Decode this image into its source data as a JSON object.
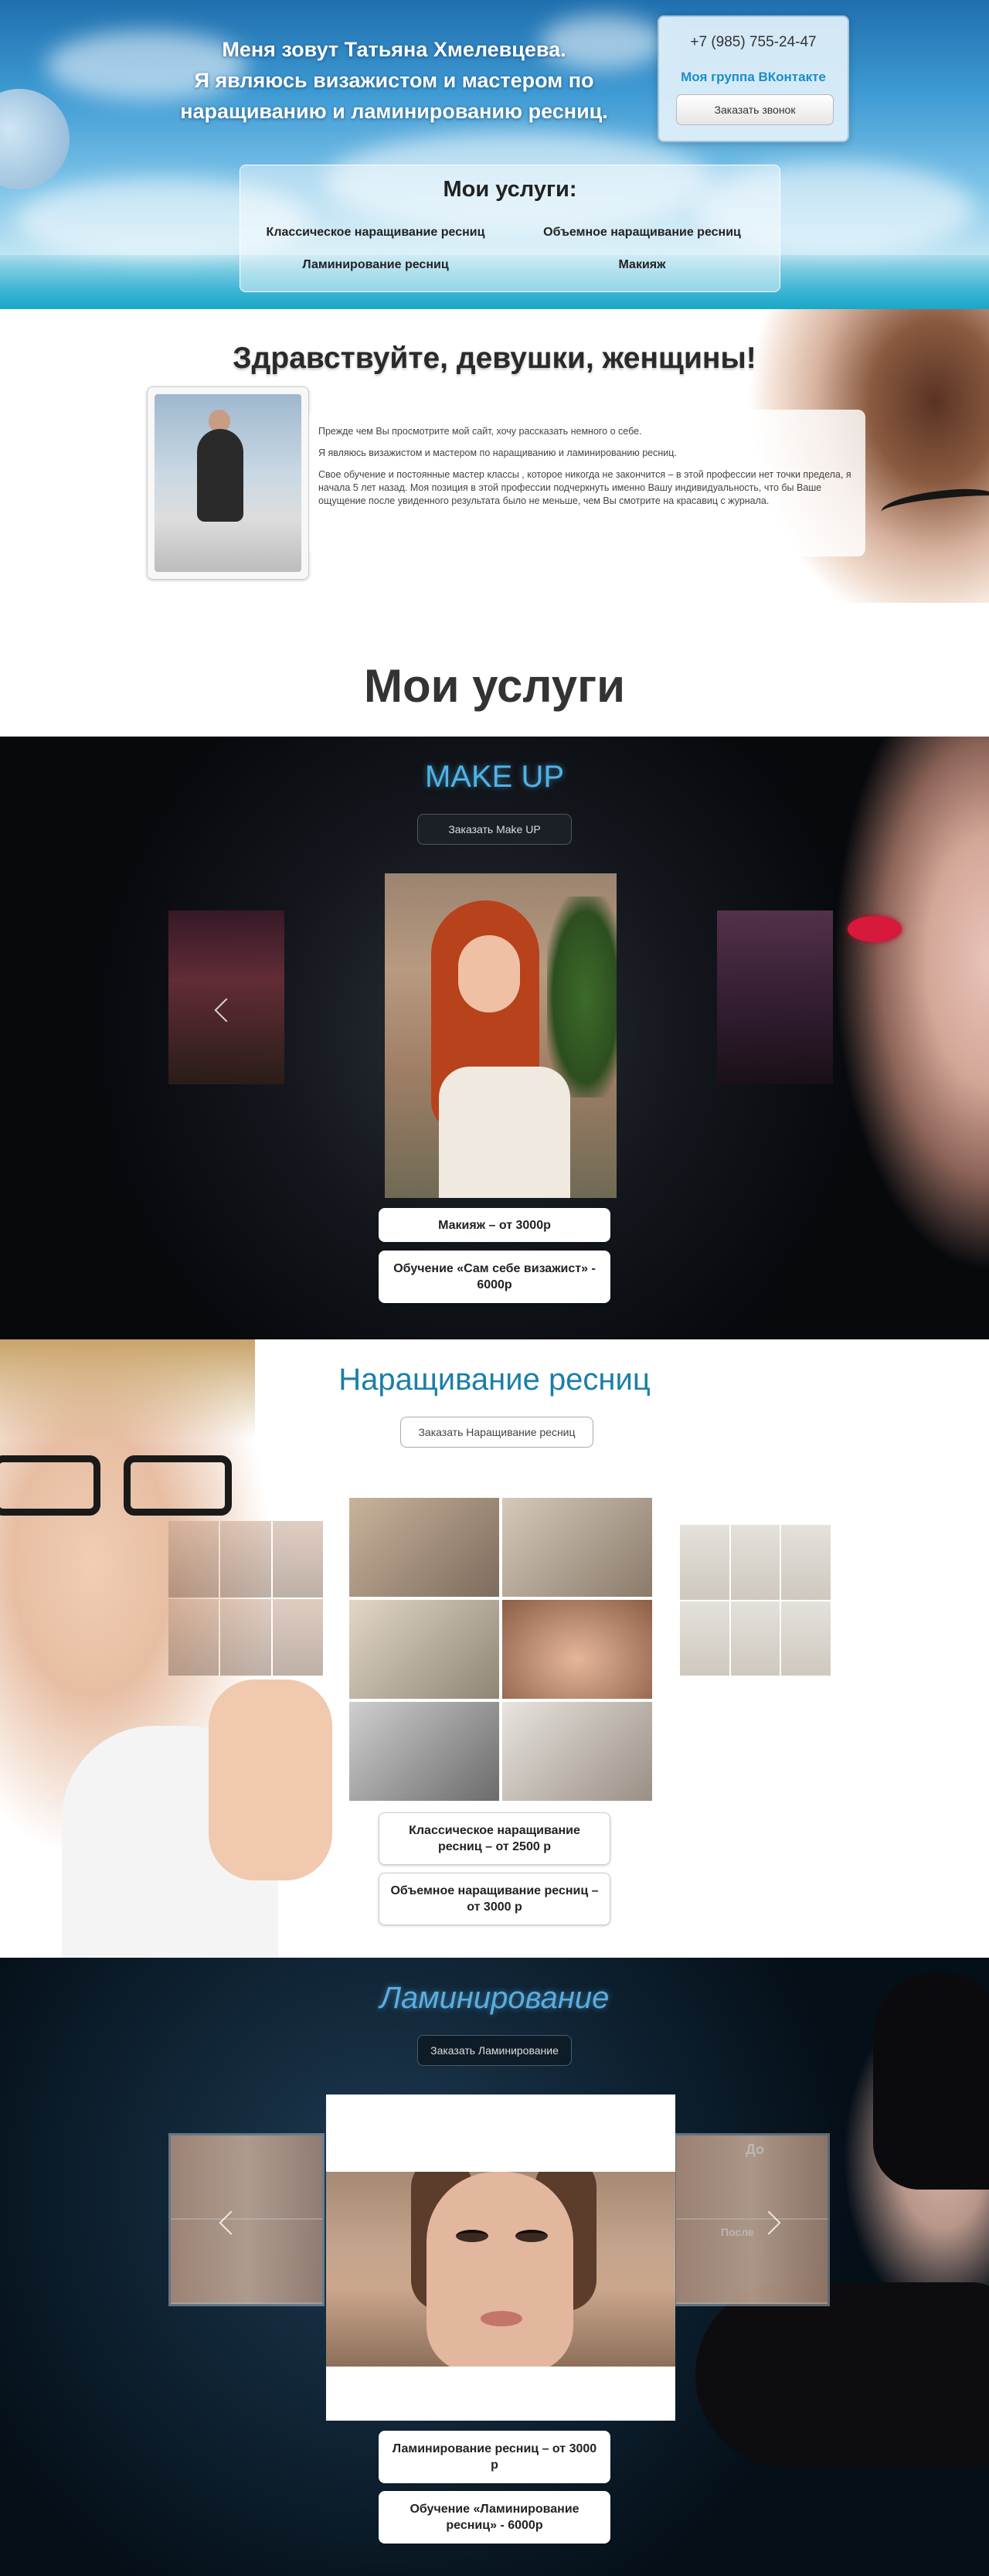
{
  "header": {
    "intro_lines": [
      "Меня зовут Татьяна Хмелевцева.",
      "Я являюсь визажистом и мастером по",
      "наращиванию и ламинированию ресниц."
    ],
    "phone": "+7 (985) 755-24-47",
    "vk_link": "Моя группа ВКонтакте",
    "call_button": "Заказать звонок",
    "services_title": "Мои услуги:",
    "services": [
      "Классическое наращивание ресниц",
      "Объемное наращивание ресниц",
      "Ламинирование ресниц",
      "Макияж"
    ]
  },
  "greeting": {
    "title": "Здравствуйте, девушки, женщины!",
    "paragraphs": [
      "Прежде чем Вы просмотрите мой сайт, хочу рассказать немного о себе.",
      "Я являюсь визажистом и мастером по наращиванию и ламинированию ресниц.",
      "Свое обучение и постоянные мастер классы , которое никогда не закончится – в этой профессии нет точки предела, я начала 5 лет назад. Моя позиция в этой профессии подчеркнуть именно Вашу индивидуальность, что бы Ваше ощущение после увиденного результата было не меньше, чем Вы смотрите на красавиц с журнала."
    ]
  },
  "services_heading": "Мои услуги",
  "makeup": {
    "title": "MAKE UP",
    "order_button": "Заказать Make UP",
    "prices": [
      "Макияж – от 3000р",
      "Обучение «Сам себе визажист» - 6000р"
    ],
    "colors": {
      "title": "#4fb3e6"
    }
  },
  "lashes": {
    "title": "Наращивание ресниц",
    "order_button": "Заказать Наращивание ресниц",
    "prices": [
      "Классическое наращивание ресниц – от 2500 р",
      "Объемное наращивание ресниц – от 3000 р"
    ],
    "colors": {
      "title": "#1a7fa8"
    }
  },
  "lamination": {
    "title": "Ламинирование",
    "order_button": "Заказать Ламинирование",
    "prices": [
      "Ламинирование ресниц – от 3000 р",
      "Обучение «Ламинирование ресниц» - 6000р"
    ],
    "side_labels": [
      "До",
      "После"
    ],
    "colors": {
      "title": "#5aaee0"
    }
  }
}
